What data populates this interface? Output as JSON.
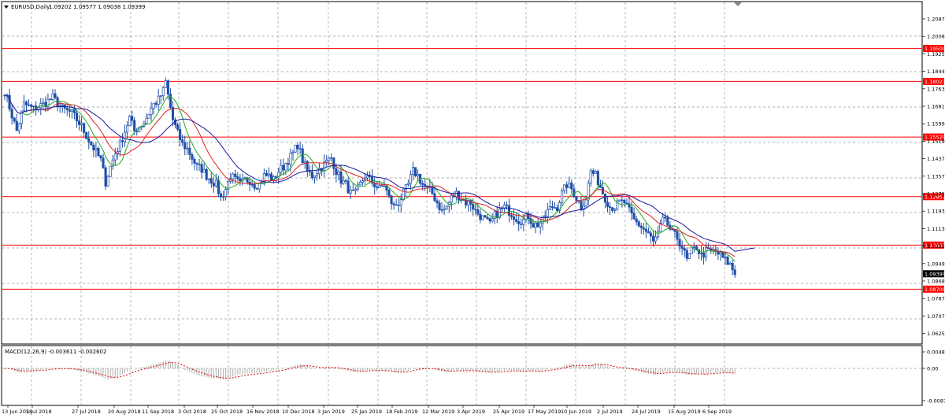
{
  "header": {
    "symbol_timeframe": "EURUSD,Daily",
    "ohlc": "1.09202 1.09577 1.09038 1.09399"
  },
  "macd": {
    "label": "MACD(12,26,9) -0.003611 -0.002602"
  },
  "price_axis": {
    "ticks": [
      "1.20870",
      "1.20080",
      "1.19250",
      "1.18440",
      "1.17630",
      "1.16810",
      "1.15990",
      "1.15190",
      "1.14370",
      "1.13570",
      "1.12750",
      "1.11930",
      "1.11130",
      "1.10310",
      "1.09490",
      "1.08680",
      "1.07870",
      "1.07070",
      "1.06250"
    ],
    "current_price": "1.09399"
  },
  "levels": [
    {
      "label": "1.19500",
      "value": 1.195
    },
    {
      "label": "1.18023",
      "value": 1.18023
    },
    {
      "label": "1.15529",
      "value": 1.15529
    },
    {
      "label": "1.12857",
      "value": 1.12857
    },
    {
      "label": "1.10685",
      "value": 1.10685
    },
    {
      "label": "1.08709",
      "value": 1.08709
    }
  ],
  "macd_axis": {
    "ticks": [
      "0.004824",
      "0.00",
      "-0.00873"
    ]
  },
  "time_axis": {
    "labels": [
      "13 Jun 2018",
      "5 Jul 2018",
      "27 Jul 2018",
      "20 Aug 2018",
      "11 Sep 2018",
      "3 Oct 2018",
      "25 Oct 2018",
      "16 Nov 2018",
      "10 Dec 2018",
      "3 Jan 2019",
      "25 Jan 2019",
      "18 Feb 2019",
      "12 Mar 2019",
      "3 Apr 2019",
      "25 Apr 2019",
      "17 May 2019",
      "10 Jun 2019",
      "2 Jul 2019",
      "24 Jul 2019",
      "15 Aug 2019",
      "6 Sep 2019"
    ]
  },
  "colors": {
    "level_line": "#ff0000",
    "candles": "#1e4fa8",
    "ma_fast": "#22aa22",
    "ma_mid": "#dd2222",
    "ma_slow": "#1a1aa0",
    "macd_signal": "#dd0000",
    "macd_hist": "#b0b0b0"
  },
  "chart_data": {
    "type": "candlestick",
    "symbol": "EURUSD",
    "timeframe": "Daily",
    "ylim": [
      1.0625,
      1.2125
    ],
    "anchors": [
      [
        0,
        1.176
      ],
      [
        3,
        1.165
      ],
      [
        5,
        1.158
      ],
      [
        8,
        1.17
      ],
      [
        12,
        1.168
      ],
      [
        16,
        1.17
      ],
      [
        20,
        1.173
      ],
      [
        24,
        1.168
      ],
      [
        28,
        1.166
      ],
      [
        32,
        1.16
      ],
      [
        36,
        1.152
      ],
      [
        40,
        1.145
      ],
      [
        42,
        1.135
      ],
      [
        44,
        1.142
      ],
      [
        46,
        1.148
      ],
      [
        48,
        1.152
      ],
      [
        50,
        1.158
      ],
      [
        52,
        1.164
      ],
      [
        54,
        1.158
      ],
      [
        56,
        1.16
      ],
      [
        58,
        1.162
      ],
      [
        60,
        1.166
      ],
      [
        62,
        1.17
      ],
      [
        64,
        1.172
      ],
      [
        66,
        1.176
      ],
      [
        67,
        1.18
      ],
      [
        68,
        1.174
      ],
      [
        70,
        1.163
      ],
      [
        72,
        1.157
      ],
      [
        74,
        1.152
      ],
      [
        76,
        1.15
      ],
      [
        78,
        1.146
      ],
      [
        80,
        1.142
      ],
      [
        82,
        1.141
      ],
      [
        84,
        1.138
      ],
      [
        86,
        1.136
      ],
      [
        88,
        1.134
      ],
      [
        90,
        1.128
      ],
      [
        92,
        1.132
      ],
      [
        94,
        1.138
      ],
      [
        96,
        1.136
      ],
      [
        98,
        1.134
      ],
      [
        100,
        1.136
      ],
      [
        102,
        1.136
      ],
      [
        104,
        1.134
      ],
      [
        106,
        1.134
      ],
      [
        108,
        1.138
      ],
      [
        110,
        1.138
      ],
      [
        112,
        1.136
      ],
      [
        114,
        1.14
      ],
      [
        116,
        1.142
      ],
      [
        118,
        1.145
      ],
      [
        120,
        1.148
      ],
      [
        122,
        1.152
      ],
      [
        124,
        1.145
      ],
      [
        126,
        1.14
      ],
      [
        128,
        1.138
      ],
      [
        130,
        1.14
      ],
      [
        132,
        1.142
      ],
      [
        134,
        1.144
      ],
      [
        136,
        1.146
      ],
      [
        138,
        1.14
      ],
      [
        140,
        1.136
      ],
      [
        142,
        1.134
      ],
      [
        144,
        1.13
      ],
      [
        146,
        1.13
      ],
      [
        148,
        1.134
      ],
      [
        150,
        1.138
      ],
      [
        152,
        1.136
      ],
      [
        154,
        1.134
      ],
      [
        156,
        1.132
      ],
      [
        158,
        1.134
      ],
      [
        160,
        1.128
      ],
      [
        162,
        1.124
      ],
      [
        164,
        1.126
      ],
      [
        166,
        1.13
      ],
      [
        168,
        1.134
      ],
      [
        170,
        1.14
      ],
      [
        172,
        1.138
      ],
      [
        174,
        1.134
      ],
      [
        176,
        1.132
      ],
      [
        178,
        1.13
      ],
      [
        180,
        1.126
      ],
      [
        182,
        1.122
      ],
      [
        184,
        1.124
      ],
      [
        186,
        1.128
      ],
      [
        188,
        1.13
      ],
      [
        190,
        1.128
      ],
      [
        192,
        1.126
      ],
      [
        194,
        1.126
      ],
      [
        196,
        1.122
      ],
      [
        198,
        1.12
      ],
      [
        200,
        1.118
      ],
      [
        202,
        1.116
      ],
      [
        204,
        1.12
      ],
      [
        206,
        1.122
      ],
      [
        208,
        1.124
      ],
      [
        210,
        1.122
      ],
      [
        212,
        1.12
      ],
      [
        214,
        1.118
      ],
      [
        216,
        1.118
      ],
      [
        218,
        1.12
      ],
      [
        220,
        1.116
      ],
      [
        222,
        1.116
      ],
      [
        224,
        1.118
      ],
      [
        226,
        1.122
      ],
      [
        228,
        1.124
      ],
      [
        230,
        1.124
      ],
      [
        232,
        1.13
      ],
      [
        234,
        1.134
      ],
      [
        236,
        1.132
      ],
      [
        238,
        1.128
      ],
      [
        240,
        1.124
      ],
      [
        242,
        1.128
      ],
      [
        244,
        1.14
      ],
      [
        246,
        1.138
      ],
      [
        248,
        1.133
      ],
      [
        250,
        1.128
      ],
      [
        252,
        1.124
      ],
      [
        254,
        1.124
      ],
      [
        256,
        1.126
      ],
      [
        258,
        1.126
      ],
      [
        260,
        1.122
      ],
      [
        262,
        1.118
      ],
      [
        264,
        1.116
      ],
      [
        266,
        1.114
      ],
      [
        268,
        1.112
      ],
      [
        270,
        1.108
      ],
      [
        272,
        1.112
      ],
      [
        274,
        1.118
      ],
      [
        276,
        1.116
      ],
      [
        278,
        1.112
      ],
      [
        280,
        1.11
      ],
      [
        282,
        1.106
      ],
      [
        284,
        1.1
      ],
      [
        286,
        1.104
      ],
      [
        288,
        1.106
      ],
      [
        290,
        1.102
      ],
      [
        292,
        1.104
      ],
      [
        294,
        1.104
      ],
      [
        296,
        1.104
      ],
      [
        298,
        1.102
      ],
      [
        300,
        1.1
      ],
      [
        302,
        1.098
      ],
      [
        304,
        1.094
      ]
    ],
    "series": [
      {
        "name": "",
        "type": "ma-fast"
      },
      {
        "name": "",
        "type": "ma-mid"
      },
      {
        "name": "",
        "type": "ma-slow"
      }
    ]
  }
}
